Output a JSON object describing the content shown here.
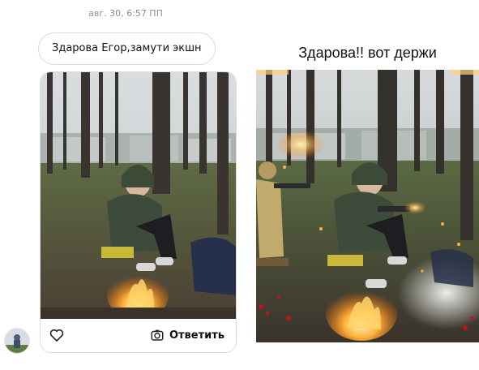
{
  "thread": {
    "timestamp": "авг. 30, 6:57 ПП",
    "message_text": "Здарова Егор,замути экшн"
  },
  "story": {
    "reply_label": "Ответить",
    "heart_icon": "heart-icon",
    "camera_icon": "camera-icon"
  },
  "reply_post": {
    "title": "Здарова!! вот держи"
  },
  "colors": {
    "bubble_border": "#dbdbdb",
    "timestamp_text": "#8e8e8e",
    "forest_green": "#4a5a3a",
    "fire_orange": "#ff8a1e",
    "blood_red": "#c0141a"
  }
}
